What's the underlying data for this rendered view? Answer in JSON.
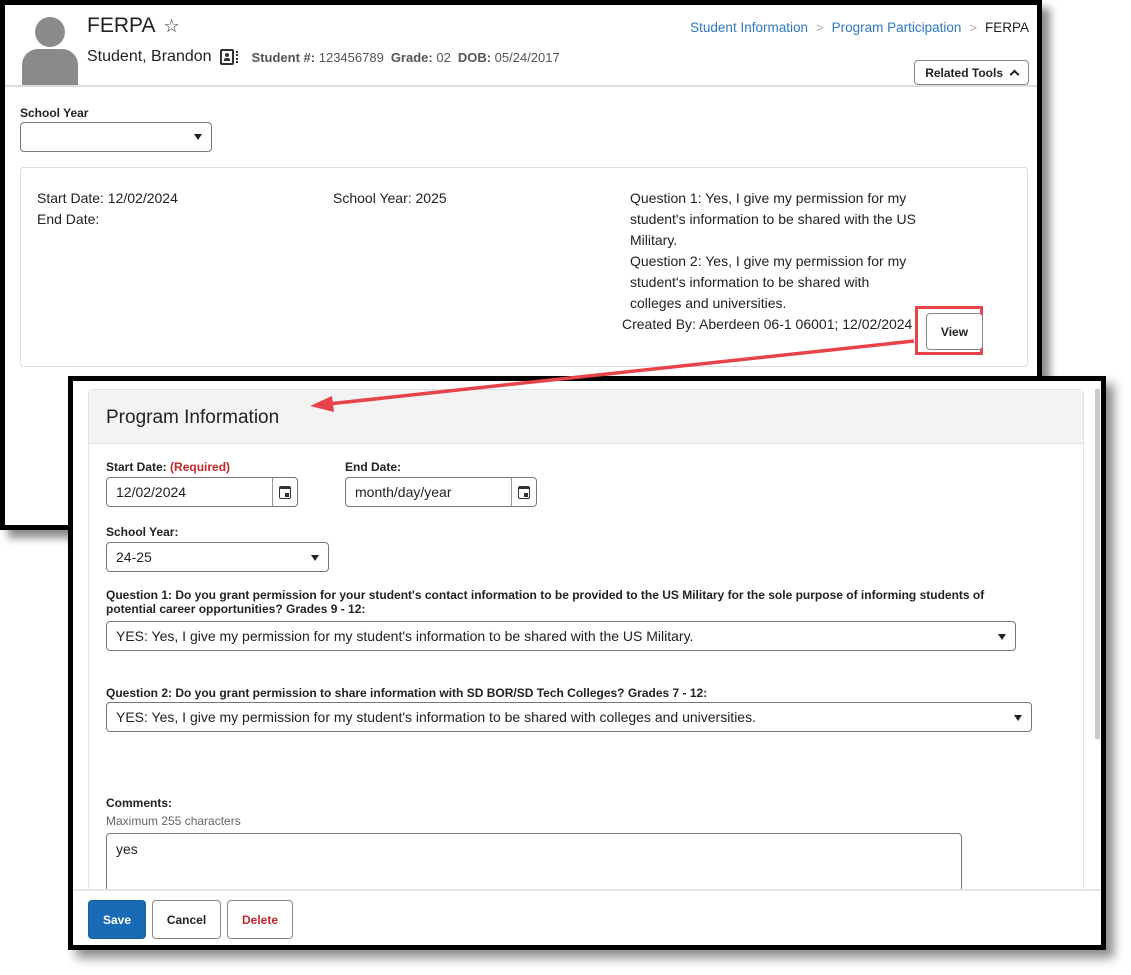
{
  "background_window": {
    "page_title": "FERPA",
    "student_name": "Student, Brandon",
    "meta": {
      "student_num_label": "Student #:",
      "student_num": "123456789",
      "grade_label": "Grade:",
      "grade": "02",
      "dob_label": "DOB:",
      "dob": "05/24/2017"
    },
    "breadcrumb": {
      "items": [
        "Student Information",
        "Program Participation",
        "FERPA"
      ],
      "separator": ">"
    },
    "related_tools_label": "Related Tools",
    "school_year_filter": {
      "label": "School Year",
      "value": ""
    },
    "record": {
      "start_date": "Start Date: 12/02/2024",
      "end_date": "End Date:",
      "school_year": "School Year: 2025",
      "question_1": "Question 1: Yes, I give my permission for my student's information to be shared with the US Military.",
      "question_2": "Question 2: Yes, I give my permission for my student's information to be shared with colleges and universities.",
      "created_by": "Created By: Aberdeen 06-1 06001; 12/02/2024",
      "view_label": "View"
    }
  },
  "modal": {
    "title": "Program Information",
    "start_date": {
      "label": "Start Date:",
      "required_label": "(Required)",
      "value": "12/02/2024"
    },
    "end_date": {
      "label": "End Date:",
      "placeholder": "month/day/year",
      "value": ""
    },
    "school_year": {
      "label": "School Year:",
      "value": "24-25"
    },
    "question_1": {
      "label": "Question 1: Do you grant permission for your student's contact information to be provided to the US Military for the sole purpose of informing students of potential career opportunities? Grades 9 - 12:",
      "value": "YES: Yes, I give my permission for my student's information to be shared with the US Military."
    },
    "question_2": {
      "label": "Question 2: Do you grant permission to share information with SD BOR/SD Tech Colleges? Grades 7 - 12:",
      "value": "YES: Yes, I give my permission for my student's information to be shared with colleges and universities."
    },
    "comments": {
      "label": "Comments:",
      "hint": "Maximum 255 characters",
      "value": "yes"
    },
    "buttons": {
      "save": "Save",
      "cancel": "Cancel",
      "delete": "Delete"
    }
  },
  "colors": {
    "link": "#2d79c4",
    "primary_button": "#1a6bb5",
    "required": "#c8262e",
    "annotation": "#e8424a"
  }
}
